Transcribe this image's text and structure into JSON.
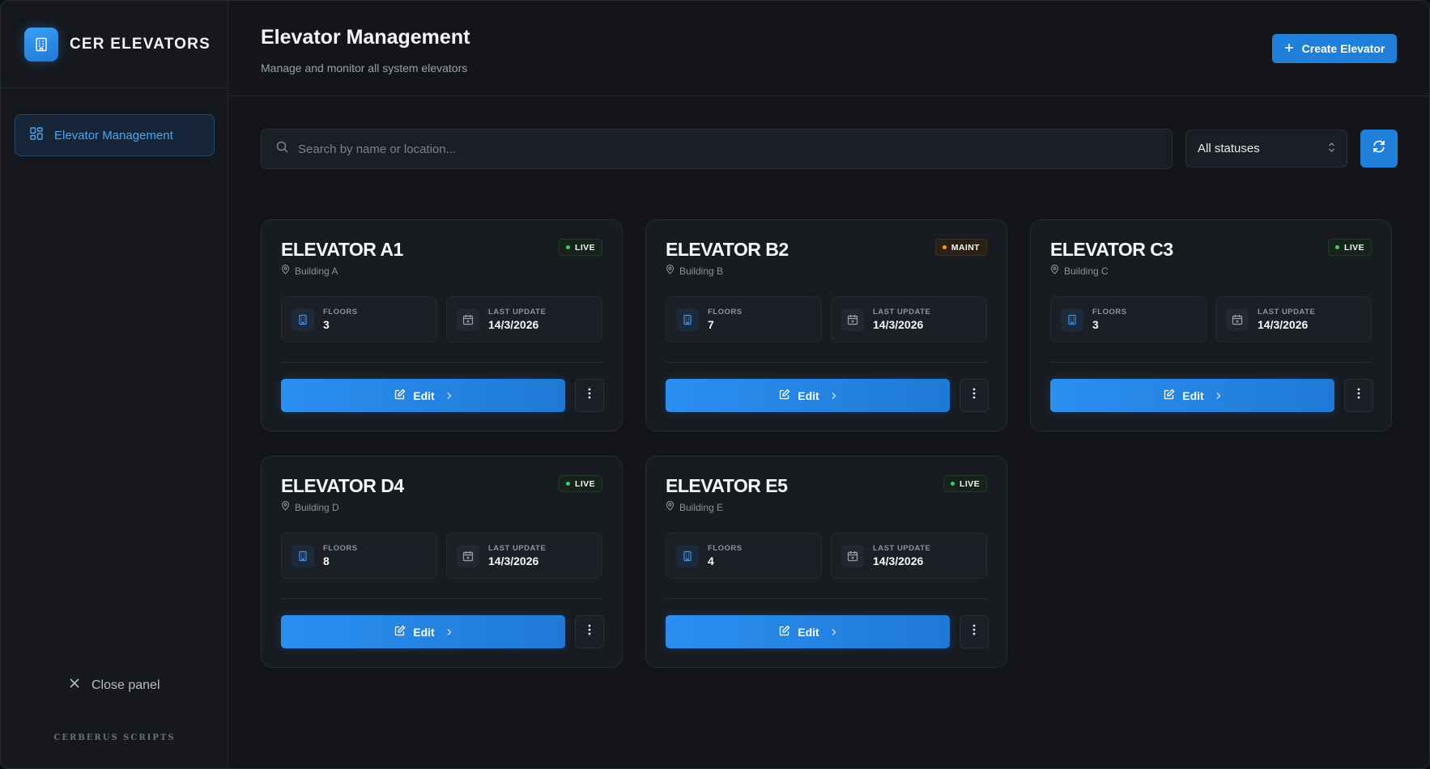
{
  "brand": {
    "name": "CER ELEVATORS",
    "footer": "CERBERUS SCRIPTS"
  },
  "sidebar": {
    "items": [
      {
        "label": "Elevator Management",
        "icon": "grid-icon",
        "active": true
      }
    ],
    "close_label": "Close panel"
  },
  "header": {
    "title": "Elevator Management",
    "subtitle": "Manage and monitor all system elevators",
    "create_label": "Create Elevator"
  },
  "filters": {
    "search_placeholder": "Search by name or location...",
    "status_value": "All statuses"
  },
  "labels": {
    "floors": "FLOORS",
    "last_update": "LAST UPDATE",
    "edit": "Edit"
  },
  "colors": {
    "accent": "#1f7fd9",
    "live": "#3ecb6a",
    "maint": "#f0a025"
  },
  "elevators": [
    {
      "name": "ELEVATOR A1",
      "location": "Building A",
      "status": "LIVE",
      "floors": "3",
      "last_update": "14/3/2026"
    },
    {
      "name": "ELEVATOR B2",
      "location": "Building B",
      "status": "MAINT",
      "floors": "7",
      "last_update": "14/3/2026"
    },
    {
      "name": "ELEVATOR C3",
      "location": "Building C",
      "status": "LIVE",
      "floors": "3",
      "last_update": "14/3/2026"
    },
    {
      "name": "ELEVATOR D4",
      "location": "Building D",
      "status": "LIVE",
      "floors": "8",
      "last_update": "14/3/2026"
    },
    {
      "name": "ELEVATOR E5",
      "location": "Building E",
      "status": "LIVE",
      "floors": "4",
      "last_update": "14/3/2026"
    }
  ]
}
